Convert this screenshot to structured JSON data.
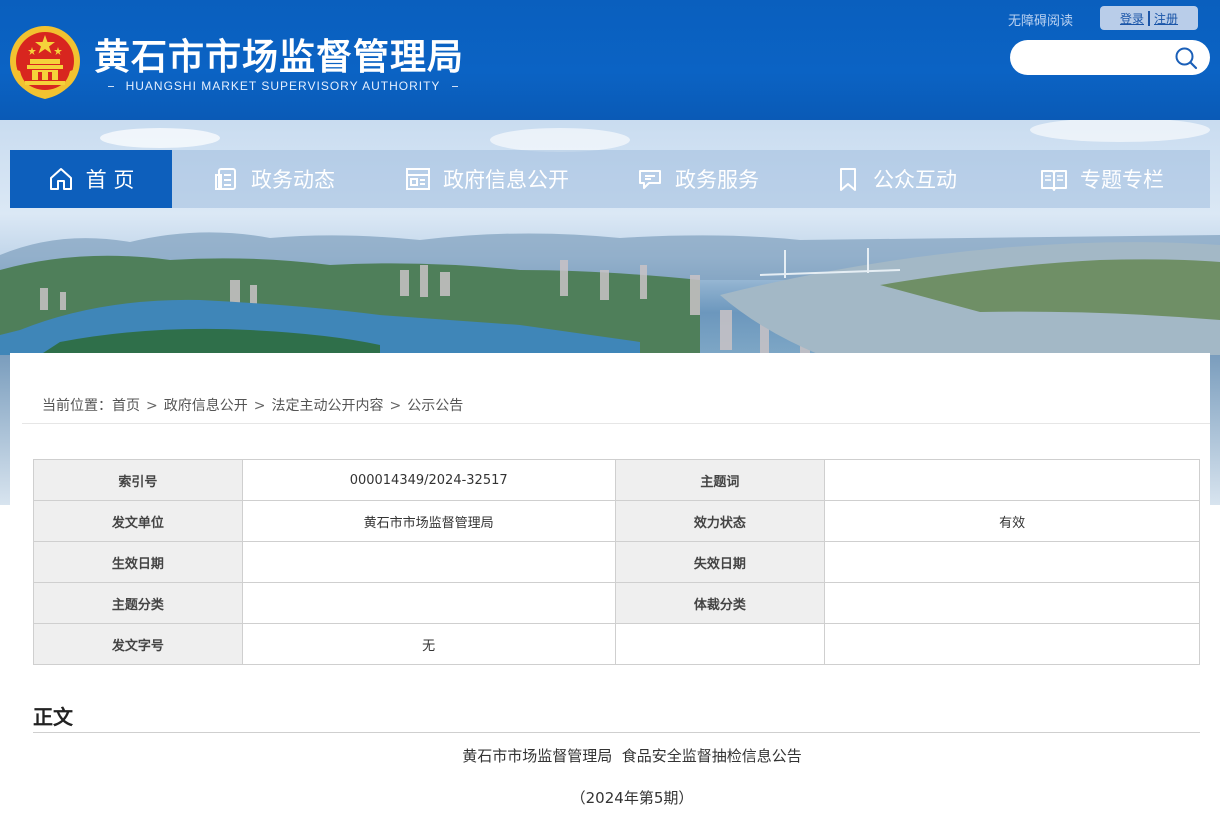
{
  "header": {
    "title": "黄石市市场监督管理局",
    "subtitle": "HUANGSHI MARKET SUPERVISORY AUTHORITY",
    "accessibility": "无障碍阅读",
    "login": "登录",
    "register": "注册",
    "search_placeholder": ""
  },
  "nav": {
    "items": [
      {
        "label": "首 页",
        "icon": "home-icon",
        "active": true
      },
      {
        "label": "政务动态",
        "icon": "document-list-icon"
      },
      {
        "label": "政府信息公开",
        "icon": "info-panel-icon"
      },
      {
        "label": "政务服务",
        "icon": "chat-service-icon"
      },
      {
        "label": "公众互动",
        "icon": "bookmark-icon"
      },
      {
        "label": "专题专栏",
        "icon": "open-book-icon"
      }
    ]
  },
  "breadcrumb": {
    "prefix": "当前位置：",
    "items": [
      "首页",
      "政府信息公开",
      "法定主动公开内容",
      "公示公告"
    ],
    "separator": ">"
  },
  "meta_table": {
    "rows": [
      [
        {
          "label": "索引号",
          "value": "000014349/2024-32517"
        },
        {
          "label": "主题词",
          "value": ""
        }
      ],
      [
        {
          "label": "发文单位",
          "value": "黄石市市场监督管理局"
        },
        {
          "label": "效力状态",
          "value": "有效"
        }
      ],
      [
        {
          "label": "生效日期",
          "value": ""
        },
        {
          "label": "失效日期",
          "value": ""
        }
      ],
      [
        {
          "label": "主题分类",
          "value": ""
        },
        {
          "label": "体裁分类",
          "value": ""
        }
      ],
      [
        {
          "label": "发文字号",
          "value": "无"
        },
        {
          "label": "",
          "value": ""
        }
      ]
    ]
  },
  "body": {
    "section_title": "正文",
    "doc_title": "黄石市市场监督管理局  食品安全监督抽检信息公告",
    "doc_issue": "（2024年第5期）"
  },
  "colors": {
    "header_blue": "#0b63c4",
    "nav_active": "#0d5fbc",
    "label_cell_bg": "#efefef"
  }
}
